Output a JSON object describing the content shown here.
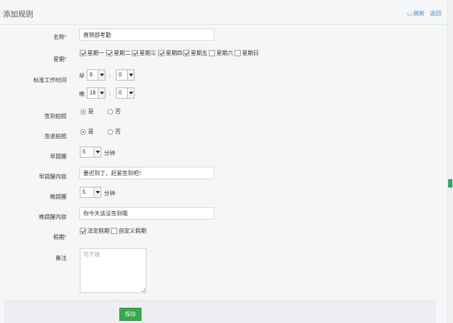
{
  "header": {
    "title": "添加规则",
    "refresh": "刷新",
    "back": "返回"
  },
  "form": {
    "name": {
      "label": "名称",
      "required": "*",
      "value": "直销部考勤"
    },
    "weekdays": {
      "label": "星期",
      "required": "*",
      "days": [
        {
          "label": "星期一",
          "checked": true
        },
        {
          "label": "星期二",
          "checked": true
        },
        {
          "label": "星期三",
          "checked": true
        },
        {
          "label": "星期四",
          "checked": true
        },
        {
          "label": "星期五",
          "checked": true
        },
        {
          "label": "星期六",
          "checked": false
        },
        {
          "label": "星期日",
          "checked": false
        }
      ]
    },
    "worktime": {
      "label": "标准工作时间",
      "morning_label": "早",
      "morning_hour": "9",
      "morning_min": "0",
      "evening_label": "晚",
      "evening_hour": "18",
      "evening_min": "0",
      "separator": ":"
    },
    "checkin_photo": {
      "label": "签到拍照",
      "yes": "是",
      "no": "否",
      "selected": "yes"
    },
    "checkout_photo": {
      "label": "签退拍照",
      "yes": "是",
      "no": "否",
      "selected": "yes"
    },
    "early_remind": {
      "label": "早提醒",
      "value": "5",
      "unit": "分钟"
    },
    "early_remind_content": {
      "label": "早提醒内容",
      "value": "要迟到了，赶紧签到吧！"
    },
    "late_remind": {
      "label": "晚提醒",
      "value": "5",
      "unit": "分钟"
    },
    "late_remind_content": {
      "label": "晚提醒内容",
      "value": "你今天该没签到哦"
    },
    "holiday": {
      "label": "假期",
      "required": "*",
      "options": [
        {
          "label": "法定假期",
          "checked": true
        },
        {
          "label": "自定义假期",
          "checked": false
        }
      ]
    },
    "remark": {
      "label": "备注",
      "placeholder": "可不填"
    }
  },
  "footer": {
    "save": "保存"
  },
  "colors": {
    "accent": "#39a849",
    "link": "#3a8ad0",
    "required": "#e4393c"
  }
}
